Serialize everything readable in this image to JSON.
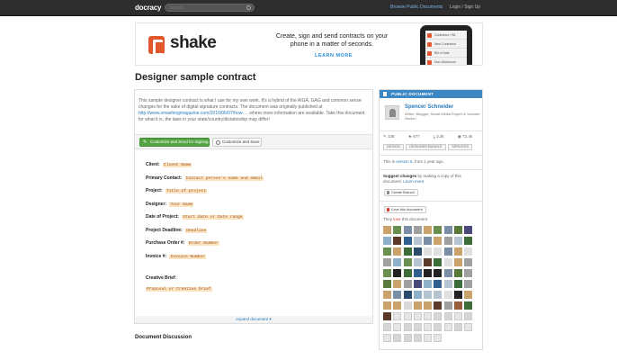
{
  "topbar": {
    "logo": "docracy",
    "search_placeholder": "Search",
    "browse_label": "Browse Public Documents",
    "login_label": "Login / Sign Up"
  },
  "ad": {
    "brand": "shake",
    "headline": "Create, sign and send contracts on your phone in a matter of seconds.",
    "cta": "LEARN MORE",
    "phone_rows": [
      "Contractor / Blt",
      "New Contractor",
      "Bill of Sale",
      "Non-Disclosure"
    ],
    "accent": "#e2572b"
  },
  "page_title": "Designer sample contract",
  "document": {
    "desc_before_link": "This sample designer contract is what I use for my own work. It's a hybrid of the AIGA, GAG and common sense changes for the sake of digital signature contracts. The document was originally published at",
    "desc_link": "http://www.smashingmagazine.com/2010/06/07/how-…",
    "desc_after_link": "where more information are available. Take this document for what it is, the laws in your state/country/dictatorship may differ!",
    "btn_customize_send": "Customize and Send for Signing",
    "btn_customize_save": "Customize and Save",
    "fields": [
      {
        "key": "Client:",
        "value": "Client Name"
      },
      {
        "key": "Primary Contact:",
        "value": "Contact person's name and email"
      },
      {
        "key": "Project:",
        "value": "Title of project"
      },
      {
        "key": "Designer:",
        "value": "Your Name"
      },
      {
        "key": "Date of Project:",
        "value": "Start date or Date range"
      },
      {
        "key": "Project Deadline:",
        "value": "Deadline"
      },
      {
        "key": "Purchase Order #:",
        "value": "Order Number"
      },
      {
        "key": "Invoice #:",
        "value": "Invoice Number"
      }
    ],
    "brief_label": "Creative Brief:",
    "brief_value": "Proposal or Creative brief",
    "expand_label": "expand document ▾",
    "discussion_label": "Document Discussion"
  },
  "sidebar": {
    "header": "PUBLIC DOCUMENT",
    "author_name": "Spencer Schneider",
    "author_bio": "Writer, Blogger, Social Media Expert & Youtube Senior!",
    "stats": [
      "135",
      "677",
      "3.2k",
      "73.4k"
    ],
    "tags": [
      "DESIGN",
      "DESIGNER BUNDLE",
      "SERVICES"
    ],
    "version_text": "This is",
    "version_link": "version 5",
    "version_after": ", from 1 year ago.",
    "suggest_bold": "Suggest changes",
    "suggest_text": "by making a copy of this document.",
    "suggest_link": "Learn more.",
    "btn_branch": "Create Branch",
    "btn_love": "Love this document",
    "loves_before": "They",
    "loves_word": "love",
    "loves_after": "this document",
    "header_color": "#3b88c5"
  }
}
